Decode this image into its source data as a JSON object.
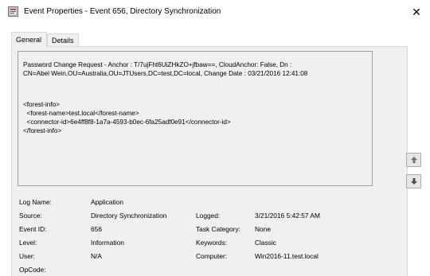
{
  "window": {
    "title": "Event Properties - Event 656, Directory Synchronization",
    "close_label": "✕"
  },
  "tabs": [
    {
      "label": "General",
      "active": true
    },
    {
      "label": "Details",
      "active": false
    }
  ],
  "description": {
    "lines": [
      "Password Change Request - Anchor : T/7ujFht6UiZHkZO+jfbaw==, CloudAnchor: False, Dn :",
      "CN=Abel Wein,OU=Australia,OU=JTUsers,DC=test,DC=local, Change Date : 03/21/2016 12:41:08",
      "<forest-info>",
      "  <forest-name>test.local</forest-name>",
      "  <connector-id>6e4ff8f8-1a7a-4593-b0ec-6fa25adf0e91</connector-id>",
      "</forest-info>"
    ]
  },
  "properties": {
    "log_name": {
      "label": "Log Name:",
      "value": "Application"
    },
    "source": {
      "label": "Source:",
      "value": "Directory Synchronization"
    },
    "logged": {
      "label": "Logged:",
      "value": "3/21/2016 5:42:57 AM"
    },
    "event_id": {
      "label": "Event ID:",
      "value": "656"
    },
    "task_category": {
      "label": "Task Category:",
      "value": "None"
    },
    "level": {
      "label": "Level:",
      "value": "Information"
    },
    "keywords": {
      "label": "Keywords:",
      "value": "Classic"
    },
    "user": {
      "label": "User:",
      "value": "N/A"
    },
    "computer": {
      "label": "Computer:",
      "value": "Win2016-11.test.local"
    },
    "opcode": {
      "label": "OpCode:",
      "value": ""
    }
  },
  "icons": {
    "app": "event-viewer-icon",
    "up": "arrow-up-icon",
    "down": "arrow-down-icon"
  },
  "colors": {
    "panel_bg": "#f0f0f0",
    "border": "#a0a0a0"
  }
}
